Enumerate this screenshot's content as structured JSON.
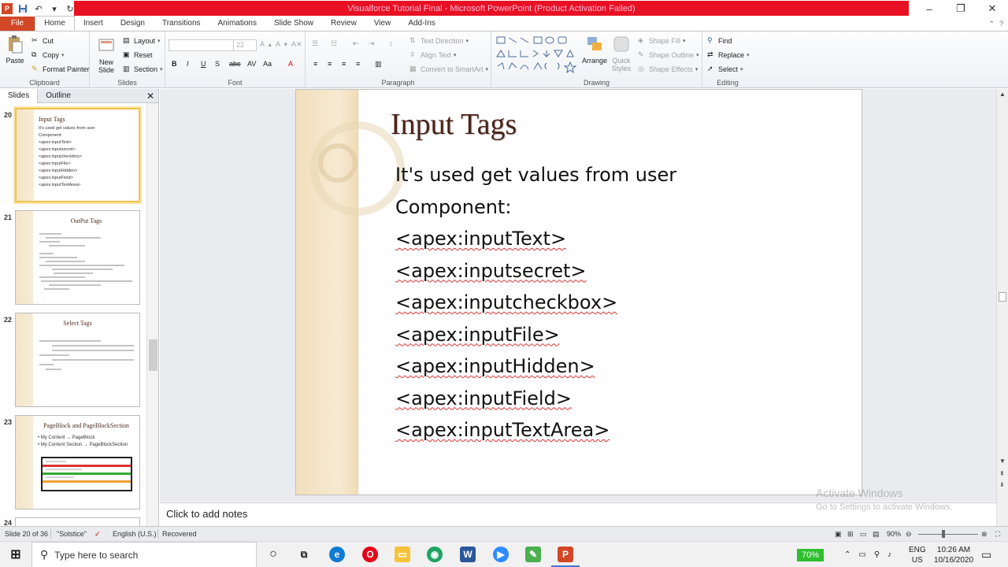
{
  "window": {
    "title": "Visualforce Tutorial Final - Microsoft PowerPoint (Product Activation Failed)",
    "controls": [
      "–",
      "❐",
      "✕"
    ]
  },
  "ribbon_tabs": [
    "File",
    "Home",
    "Insert",
    "Design",
    "Transitions",
    "Animations",
    "Slide Show",
    "Review",
    "View",
    "Add-Ins"
  ],
  "ribbon": {
    "clipboard": {
      "label": "Clipboard",
      "paste": "Paste",
      "cut": "Cut",
      "copy": "Copy",
      "format_painter": "Format Painter"
    },
    "slides": {
      "label": "Slides",
      "new_slide": "New Slide",
      "layout": "Layout",
      "reset": "Reset",
      "section": "Section"
    },
    "font": {
      "label": "Font",
      "size": "22"
    },
    "paragraph": {
      "label": "Paragraph",
      "text_direction": "Text Direction",
      "align_text": "Align Text",
      "convert_smartart": "Convert to SmartArt"
    },
    "drawing": {
      "label": "Drawing",
      "arrange": "Arrange",
      "quick_styles": "Quick Styles",
      "shape_fill": "Shape Fill",
      "shape_outline": "Shape Outline",
      "shape_effects": "Shape Effects"
    },
    "editing": {
      "label": "Editing",
      "find": "Find",
      "replace": "Replace",
      "select": "Select"
    }
  },
  "panel": {
    "tabs": [
      "Slides",
      "Outline"
    ],
    "thumbnails": [
      {
        "num": "20",
        "title": "Input Tags",
        "lines": [
          "It's used get values from user",
          "Component:",
          "<apex:inputText>",
          "<apex:inputsecret>",
          "<apex:inputcheckbox>",
          "<apex:inputFile>",
          "<apex:inputHidden>",
          "<apex:inputField>",
          "<apex:inputTextArea>"
        ]
      },
      {
        "num": "21",
        "title": "OutPut Tags"
      },
      {
        "num": "22",
        "title": "Select Tags"
      },
      {
        "num": "23",
        "title": "PageBlock and PageBlockSection",
        "lines": [
          "• My Content → PageBlock",
          "• My Content Section → PageBlockSection"
        ]
      },
      {
        "num": "24"
      }
    ]
  },
  "slide": {
    "title": "Input Tags",
    "lines": [
      "It's used get values from user",
      "Component:",
      "<apex:inputText>",
      "<apex:inputsecret>",
      "<apex:inputcheckbox>",
      "<apex:inputFile>",
      "<apex:inputHidden>",
      "<apex:inputField>",
      "<apex:inputTextArea>"
    ]
  },
  "notes_placeholder": "Click to add notes",
  "watermark": {
    "line1": "Activate Windows",
    "line2": "Go to Settings to activate Windows."
  },
  "status": {
    "slide": "Slide 20 of 36",
    "theme": "\"Solstice\"",
    "language": "English (U.S.)",
    "recovered": "Recovered",
    "zoom": "90%"
  },
  "taskbar": {
    "search_placeholder": "Type here to search",
    "battery": "70%",
    "lang1": "ENG",
    "lang2": "US",
    "time": "10:26 AM",
    "date": "10/16/2020"
  },
  "colors": {
    "file_tab": "#d24726",
    "title_band": "#e81123",
    "slide_title": "#4a2318",
    "selected_thumb": "#f2c24b"
  }
}
